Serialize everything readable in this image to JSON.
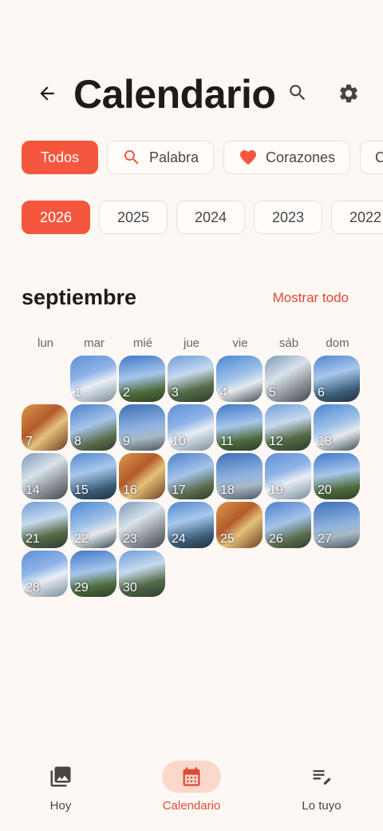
{
  "header": {
    "title": "Calendario"
  },
  "filters": [
    {
      "label": "Todos",
      "icon": "",
      "active": true
    },
    {
      "label": "Palabra",
      "icon": "search-icon",
      "active": false
    },
    {
      "label": "Corazones",
      "icon": "heart-icon",
      "active": false
    },
    {
      "label": "C",
      "icon": "",
      "active": false
    }
  ],
  "years": [
    {
      "label": "2026",
      "active": true
    },
    {
      "label": "2025",
      "active": false
    },
    {
      "label": "2024",
      "active": false
    },
    {
      "label": "2023",
      "active": false
    },
    {
      "label": "2022",
      "active": false
    }
  ],
  "calendar": {
    "month": "septiembre",
    "show_all": "Mostrar todo",
    "weekdays": [
      "lun",
      "mar",
      "mié",
      "jue",
      "vie",
      "sáb",
      "dom"
    ],
    "first_weekday_index": 1,
    "days": [
      "1",
      "2",
      "3",
      "4",
      "5",
      "6",
      "7",
      "8",
      "9",
      "10",
      "11",
      "12",
      "13",
      "14",
      "15",
      "16",
      "17",
      "18",
      "19",
      "20",
      "21",
      "22",
      "23",
      "24",
      "25",
      "26",
      "27",
      "28",
      "29",
      "30"
    ]
  },
  "bottom_nav": [
    {
      "label": "Hoy",
      "icon": "photos-icon",
      "active": false
    },
    {
      "label": "Calendario",
      "icon": "calendar-icon",
      "active": true
    },
    {
      "label": "Lo tuyo",
      "icon": "notes-icon",
      "active": false
    }
  ],
  "colors": {
    "accent": "#f4573e",
    "accent_text": "#e04a33",
    "background": "#fdf8f4"
  }
}
